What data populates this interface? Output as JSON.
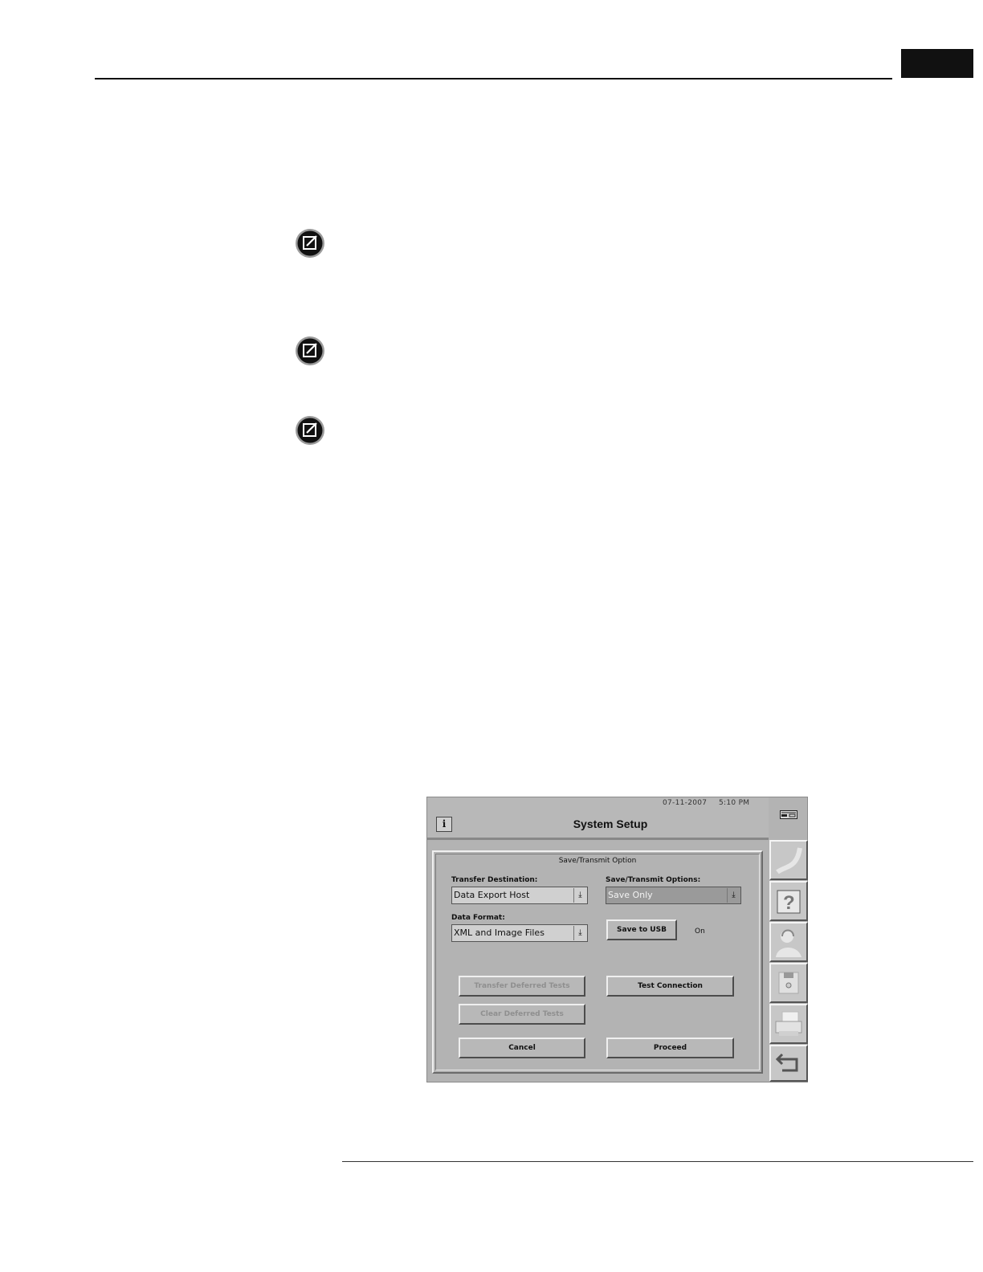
{
  "screen": {
    "date": "07-11-2007",
    "time": "5:10 PM",
    "title": "System Setup",
    "info_button": "i",
    "panel_title": "Save/Transmit Option",
    "transfer_destination": {
      "label": "Transfer Destination:",
      "value": "Data Export Host"
    },
    "save_transmit_options": {
      "label": "Save/Transmit Options:",
      "value": "Save Only"
    },
    "data_format": {
      "label": "Data Format:",
      "value": "XML and Image Files"
    },
    "save_to_usb_label": "Save to USB",
    "usb_status": "On",
    "transfer_deferred_label": "Transfer Deferred Tests",
    "test_connection_label": "Test Connection",
    "clear_deferred_label": "Clear Deferred Tests",
    "cancel_label": "Cancel",
    "proceed_label": "Proceed",
    "sidebar_icons": [
      "blank-icon",
      "help-icon",
      "operator-icon",
      "floppy-disk-icon",
      "printer-icon",
      "return-icon"
    ]
  }
}
